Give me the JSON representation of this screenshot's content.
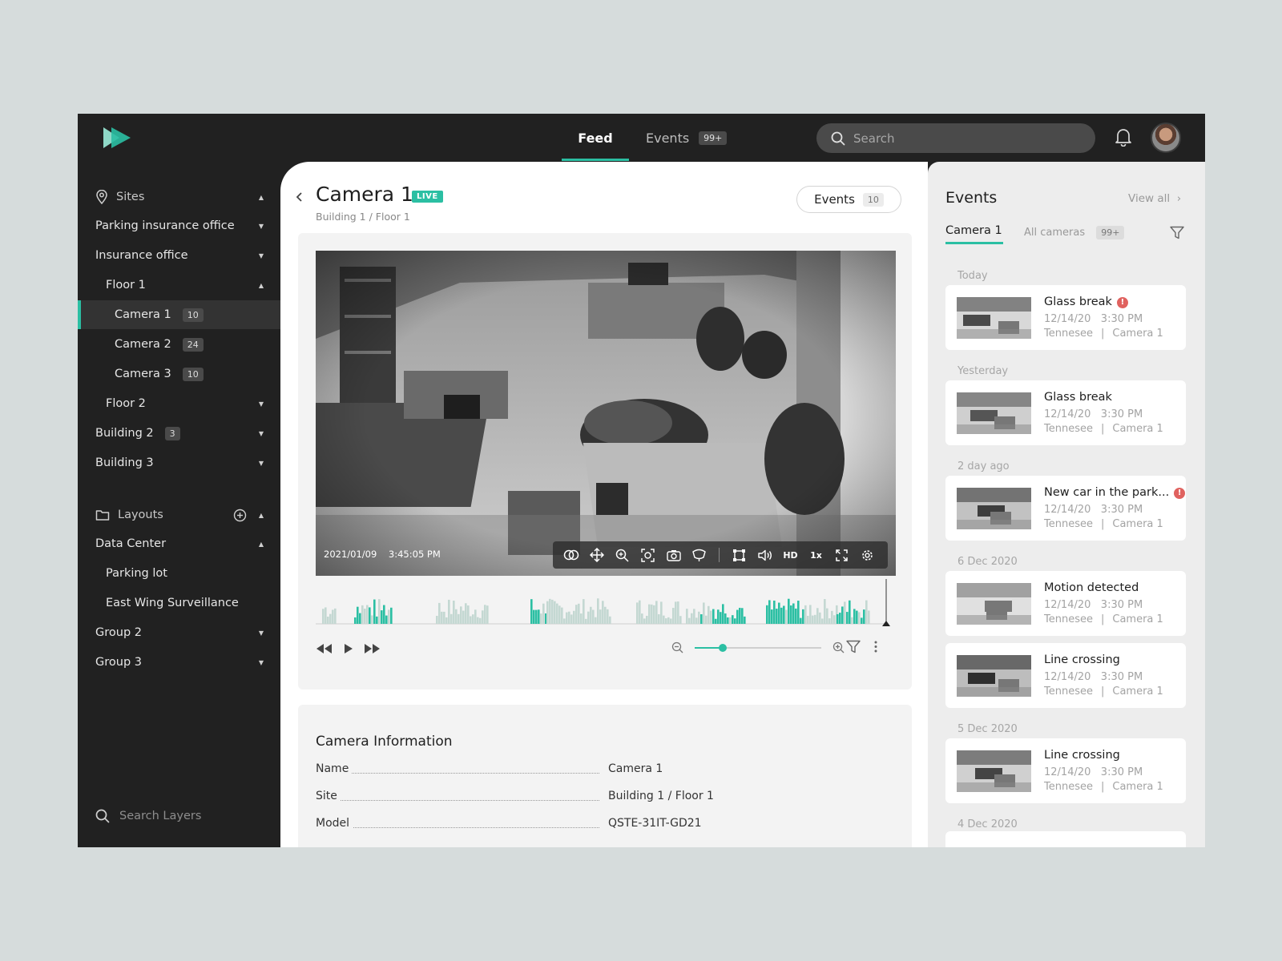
{
  "topbar": {
    "logo": "play-logo",
    "nav": [
      {
        "label": "Feed",
        "active": true
      },
      {
        "label": "Events",
        "badge": "99+"
      }
    ],
    "search_placeholder": "Search",
    "notifications_icon": "bell-icon",
    "avatar": "user-avatar"
  },
  "sidebar": {
    "sites_label": "Sites",
    "sites": [
      {
        "label": "Parking insurance office",
        "level": 0,
        "caret": "down"
      },
      {
        "label": "Insurance office",
        "level": 0,
        "caret": "down"
      },
      {
        "label": "Floor 1",
        "level": 1,
        "caret": "up"
      },
      {
        "label": "Camera 1",
        "level": 2,
        "badge": "10",
        "active": true
      },
      {
        "label": "Camera 2",
        "level": 2,
        "badge": "24"
      },
      {
        "label": "Camera 3",
        "level": 2,
        "badge": "10"
      },
      {
        "label": "Floor 2",
        "level": 1,
        "caret": "down"
      },
      {
        "label": "Building 2",
        "level": 0,
        "badge": "3",
        "caret": "down"
      },
      {
        "label": "Building 3",
        "level": 0,
        "caret": "down"
      }
    ],
    "layouts_label": "Layouts",
    "layouts": [
      {
        "label": "Data Center",
        "level": 0,
        "caret": "up"
      },
      {
        "label": "Parking lot",
        "level": 1
      },
      {
        "label": "East Wing Surveillance",
        "level": 1
      },
      {
        "label": "Group 2",
        "level": 0,
        "caret": "down"
      },
      {
        "label": "Group 3",
        "level": 0,
        "caret": "down"
      }
    ],
    "search_placeholder": "Search Layers"
  },
  "main": {
    "title": "Camera 1",
    "live_label": "LIVE",
    "path": "Building 1 / Floor 1",
    "events_button": {
      "label": "Events",
      "badge": "10"
    },
    "video": {
      "date": "2021/01/09",
      "time": "3:45:05 PM",
      "toolbar": [
        "link-icon",
        "move-icon",
        "zoom-in-icon",
        "focus-icon",
        "camera-icon",
        "fisheye-icon",
        "crop-icon",
        "volume-icon",
        "HD",
        "1x",
        "fullscreen-icon",
        "settings-icon"
      ]
    },
    "zoom_level": 0.22,
    "camera_info": {
      "title": "Camera Information",
      "rows": [
        {
          "label": "Name",
          "value": "Camera 1"
        },
        {
          "label": "Site",
          "value": "Building 1 / Floor 1"
        },
        {
          "label": "Model",
          "value": "QSTE-31IT-GD21"
        }
      ]
    }
  },
  "events_panel": {
    "title": "Events",
    "view_all": "View all",
    "tabs": [
      {
        "label": "Camera 1",
        "active": true
      },
      {
        "label": "All cameras",
        "badge": "99+"
      }
    ],
    "groups": [
      {
        "label": "Today",
        "items": [
          {
            "name": "Glass break",
            "alert": true,
            "date": "12/14/20",
            "time": "3:30 PM",
            "location": "Tennesee",
            "camera": "Camera 1"
          }
        ]
      },
      {
        "label": "Yesterday",
        "items": [
          {
            "name": "Glass break",
            "alert": false,
            "date": "12/14/20",
            "time": "3:30 PM",
            "location": "Tennesee",
            "camera": "Camera 1"
          }
        ]
      },
      {
        "label": "2 day ago",
        "items": [
          {
            "name": "New car in the park...",
            "alert": true,
            "date": "12/14/20",
            "time": "3:30 PM",
            "location": "Tennesee",
            "camera": "Camera 1"
          }
        ]
      },
      {
        "label": "6 Dec 2020",
        "items": [
          {
            "name": "Motion detected",
            "alert": false,
            "date": "12/14/20",
            "time": "3:30 PM",
            "location": "Tennesee",
            "camera": "Camera 1"
          },
          {
            "name": "Line crossing",
            "alert": false,
            "date": "12/14/20",
            "time": "3:30 PM",
            "location": "Tennesee",
            "camera": "Camera 1"
          }
        ]
      },
      {
        "label": "5 Dec 2020",
        "items": [
          {
            "name": "Line crossing",
            "alert": false,
            "date": "12/14/20",
            "time": "3:30 PM",
            "location": "Tennesee",
            "camera": "Camera 1"
          }
        ]
      },
      {
        "label": "4 Dec 2020",
        "items": []
      }
    ]
  },
  "colors": {
    "accent": "#2bbfa3",
    "sidebar": "#212121",
    "alert": "#e0625f"
  }
}
